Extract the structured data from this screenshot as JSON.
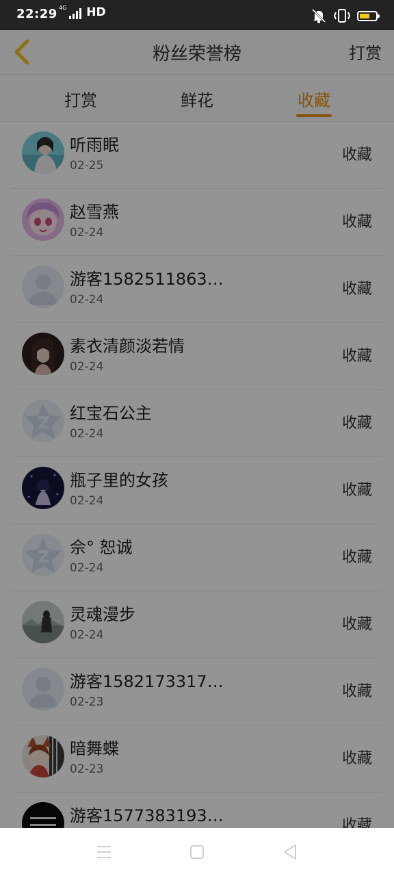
{
  "status": {
    "time": "22:29",
    "network": "4G",
    "hd": "HD"
  },
  "header": {
    "title": "粉丝荣誉榜",
    "action": "打赏"
  },
  "tabs": [
    {
      "label": "打赏"
    },
    {
      "label": "鲜花"
    },
    {
      "label": "收藏"
    }
  ],
  "active_tab": 2,
  "list": [
    {
      "name": "听雨眠",
      "date": "02-25",
      "action": "收藏",
      "avatar": "photo-girl-avatar"
    },
    {
      "name": "赵雪燕",
      "date": "02-24",
      "action": "收藏",
      "avatar": "anime-girl-avatar"
    },
    {
      "name": "游客1582511863…",
      "date": "02-24",
      "action": "收藏",
      "avatar": "default-user-avatar"
    },
    {
      "name": "素衣清颜淡若情",
      "date": "02-24",
      "action": "收藏",
      "avatar": "photo-woman-avatar"
    },
    {
      "name": "红宝石公主",
      "date": "02-24",
      "action": "收藏",
      "avatar": "qq-star-avatar"
    },
    {
      "name": "瓶子里的女孩",
      "date": "02-24",
      "action": "收藏",
      "avatar": "night-girl-avatar"
    },
    {
      "name": "佘° 恕诚",
      "date": "02-24",
      "action": "收藏",
      "avatar": "qq-star-avatar"
    },
    {
      "name": "灵魂漫步",
      "date": "02-24",
      "action": "收藏",
      "avatar": "landscape-avatar"
    },
    {
      "name": "游客1582173317…",
      "date": "02-23",
      "action": "收藏",
      "avatar": "default-user-avatar"
    },
    {
      "name": "暗舞蝶",
      "date": "02-23",
      "action": "收藏",
      "avatar": "anime-fox-avatar"
    },
    {
      "name": "游客1577383193…",
      "date": "",
      "action": "收藏",
      "avatar": "black-text-avatar"
    }
  ],
  "colors": {
    "accent": "#e8900f",
    "status_bar": "#232323",
    "battery": "#f2cc1a"
  }
}
